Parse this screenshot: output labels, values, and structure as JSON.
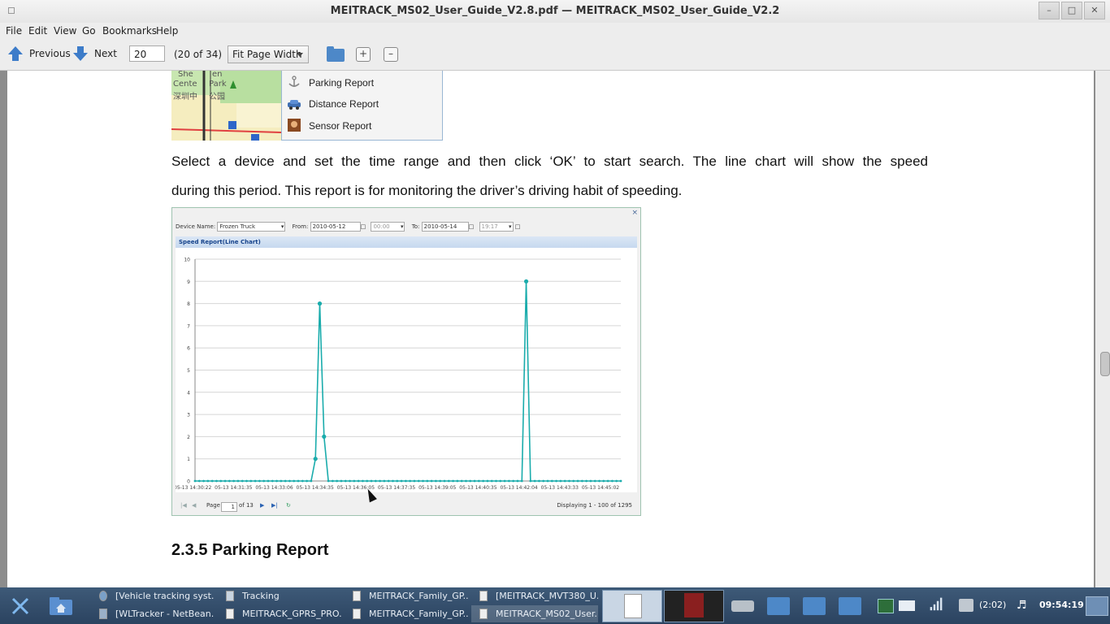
{
  "window": {
    "title": "MEITRACK_MS02_User_Guide_V2.8.pdf — MEITRACK_MS02_User_Guide_V2.2",
    "buttons": [
      "minimize",
      "maximize",
      "close"
    ]
  },
  "menu": [
    "File",
    "Edit",
    "View",
    "Go",
    "Bookmarks",
    "Help"
  ],
  "toolbar": {
    "previous_label": "Previous",
    "next_label": "Next",
    "page_value": "20",
    "page_count": "(20 of 34)",
    "zoom_value": "Fit Page Width"
  },
  "document": {
    "map_labels": [
      "She",
      "en",
      "Cente",
      "Park",
      "深圳中",
      "公园"
    ],
    "report_menu": [
      "Parking Report",
      "Distance Report",
      "Sensor Report"
    ],
    "paragraph_line1": "Select a device and set the time range and then click ‘OK’ to start search. The line chart will show the speed",
    "paragraph_line2": "during this period. This report is for monitoring the driver’s driving habit of speeding.",
    "heading": "2.3.5 Parking Report"
  },
  "speed_report": {
    "close_glyph": "×",
    "device_label": "Device Name:",
    "device_value": "Frozen Truck",
    "from_label": "From:",
    "from_date": "2010-05-12",
    "from_time": "00:00",
    "to_label": "To:",
    "to_date": "2010-05-14",
    "to_time": "19:17",
    "panel_title": "Speed Report(Line Chart)",
    "pager_page_label": "Page",
    "pager_page_value": "1",
    "pager_of": "of 13",
    "pager_display": "Displaying 1 - 100 of 1295"
  },
  "chart_data": {
    "type": "line",
    "title": "Speed Report(Line Chart)",
    "xlabel": "",
    "ylabel": "",
    "ylim": [
      0,
      10
    ],
    "yticks": [
      0,
      1,
      2,
      3,
      4,
      5,
      6,
      7,
      8,
      9,
      10
    ],
    "xtick_labels": [
      "05-13 14:30:22",
      "05-13 14:31:35",
      "05-13 14:33:06",
      "05-13 14:34:35",
      "05-13 14:36:05",
      "05-13 14:37:35",
      "05-13 14:39:05",
      "05-13 14:40:35",
      "05-13 14:42:04",
      "05-13 14:43:33",
      "05-13 14:45:02"
    ],
    "series": [
      {
        "color": "#1aacac",
        "values": [
          0,
          0,
          0,
          0,
          0,
          0,
          0,
          0,
          0,
          0,
          0,
          0,
          0,
          0,
          0,
          0,
          0,
          0,
          0,
          0,
          0,
          0,
          0,
          0,
          0,
          0,
          0,
          0,
          1,
          8,
          2,
          0,
          0,
          0,
          0,
          0,
          0,
          0,
          0,
          0,
          0,
          0,
          0,
          0,
          0,
          0,
          0,
          0,
          0,
          0,
          0,
          0,
          0,
          0,
          0,
          0,
          0,
          0,
          0,
          0,
          0,
          0,
          0,
          0,
          0,
          0,
          0,
          0,
          0,
          0,
          0,
          0,
          0,
          0,
          0,
          0,
          0,
          9,
          0,
          0,
          0,
          0,
          0,
          0,
          0,
          0,
          0,
          0,
          0,
          0,
          0,
          0,
          0,
          0,
          0,
          0,
          0,
          0,
          0,
          0
        ]
      }
    ]
  },
  "taskbar": {
    "tasks_top": [
      "[Vehicle tracking syst...",
      "Tracking",
      "MEITRACK_Family_GP...",
      "[MEITRACK_MVT380_U..."
    ],
    "tasks_bottom": [
      "[WLTracker - NetBean...",
      "MEITRACK_GPRS_PRO...",
      "MEITRACK_Family_GP...",
      "MEITRACK_MS02_User..."
    ],
    "battery": "(2:02)",
    "clock": "09:54:19"
  }
}
